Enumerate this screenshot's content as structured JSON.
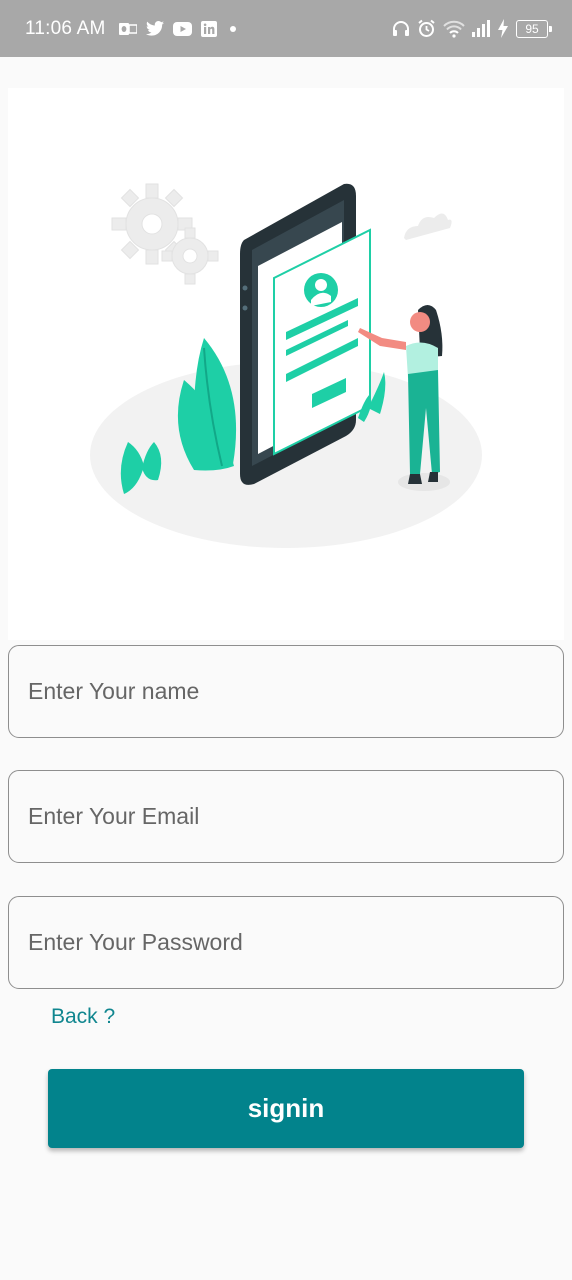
{
  "status_bar": {
    "time": "11:06 AM",
    "left_icons": [
      "outlook-icon",
      "twitter-icon",
      "youtube-icon",
      "linkedin-icon",
      "notification-dot-icon"
    ],
    "right_icons": [
      "headphones-icon",
      "alarm-icon",
      "wifi-icon",
      "signal-icon",
      "charging-icon"
    ],
    "battery": "95"
  },
  "hero": {
    "illustration": "registration-illustration",
    "accent_color": "#1ecfa6"
  },
  "form": {
    "name_placeholder": "Enter Your name",
    "email_placeholder": "Enter Your Email",
    "password_placeholder": "Enter Your Password",
    "back_label": "Back ?",
    "signin_label": "signin"
  },
  "colors": {
    "status_bar_bg": "#a8a8a8",
    "primary": "#02838c",
    "link": "#10868f"
  }
}
